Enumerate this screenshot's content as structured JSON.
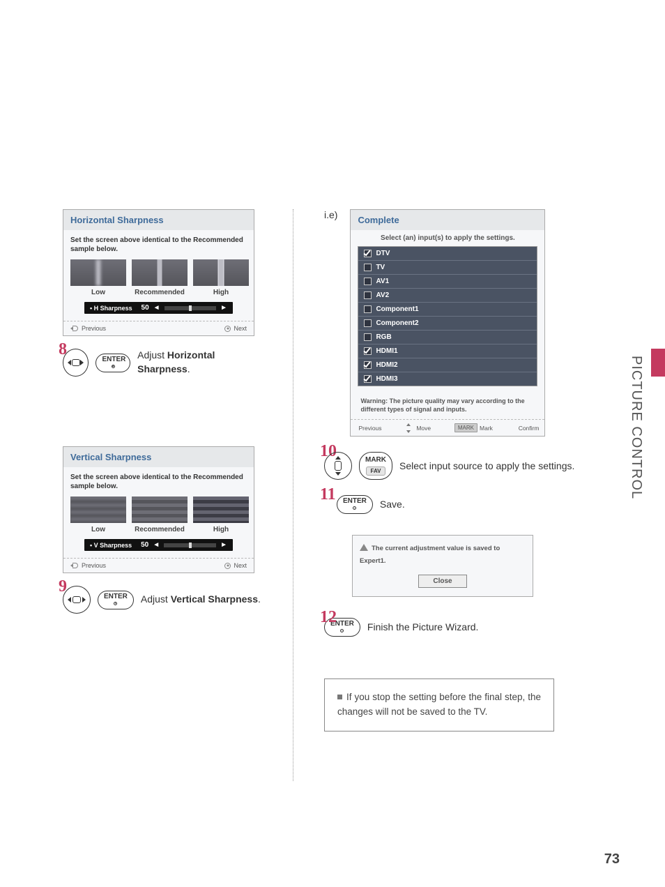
{
  "sideLabel": "PICTURE CONTROL",
  "pageNumber": "73",
  "panelH": {
    "title": "Horizontal Sharpness",
    "desc": "Set the screen above identical to the Recommended sample  below.",
    "labels": {
      "low": "Low",
      "rec": "Recommended",
      "high": "High"
    },
    "slider": {
      "name": "• H Sharpness",
      "value": "50"
    },
    "footer": {
      "prev": "Previous",
      "next": "Next"
    }
  },
  "step8": {
    "num": "8",
    "btn": "ENTER",
    "text1": "Adjust ",
    "bold": "Horizontal Sharpness",
    "text2": "."
  },
  "panelV": {
    "title": "Vertical Sharpness",
    "desc": "Set the screen above identical to the Recommended sample  below.",
    "labels": {
      "low": "Low",
      "rec": "Recommended",
      "high": "High"
    },
    "slider": {
      "name": "• V Sharpness",
      "value": "50"
    },
    "footer": {
      "prev": "Previous",
      "next": "Next"
    }
  },
  "step9": {
    "num": "9",
    "btn": "ENTER",
    "text1": "Adjust ",
    "bold": "Vertical Sharpness",
    "text2": "."
  },
  "ie": "i.e)",
  "complete": {
    "title": "Complete",
    "sub": "Select (an) input(s) to apply the settings.",
    "inputs": [
      {
        "name": "DTV",
        "checked": true
      },
      {
        "name": "TV",
        "checked": false
      },
      {
        "name": "AV1",
        "checked": false
      },
      {
        "name": "AV2",
        "checked": false
      },
      {
        "name": "Component1",
        "checked": false
      },
      {
        "name": "Component2",
        "checked": false
      },
      {
        "name": "RGB",
        "checked": false
      },
      {
        "name": "HDMI1",
        "checked": true
      },
      {
        "name": "HDMI2",
        "checked": true
      },
      {
        "name": "HDMI3",
        "checked": true
      }
    ],
    "warning": "Warning: The picture quality may vary according to the different types of signal and inputs.",
    "footer": {
      "prev": "Previous",
      "move": "Move",
      "markBtn": "MARK",
      "mark": "Mark",
      "confirm": "Confirm"
    }
  },
  "step10": {
    "num": "10",
    "btn1": "MARK",
    "btn2": "FAV",
    "text": "Select input source to apply the settings."
  },
  "step11": {
    "num": "11",
    "btn": "ENTER",
    "text": "Save."
  },
  "savePanel": {
    "msg": "The current adjustment value is saved to Expert1.",
    "close": "Close"
  },
  "step12": {
    "num": "12",
    "btn": "ENTER",
    "text": "Finish the Picture Wizard."
  },
  "note": "If you stop the setting before the final step, the changes will not be saved to the TV."
}
